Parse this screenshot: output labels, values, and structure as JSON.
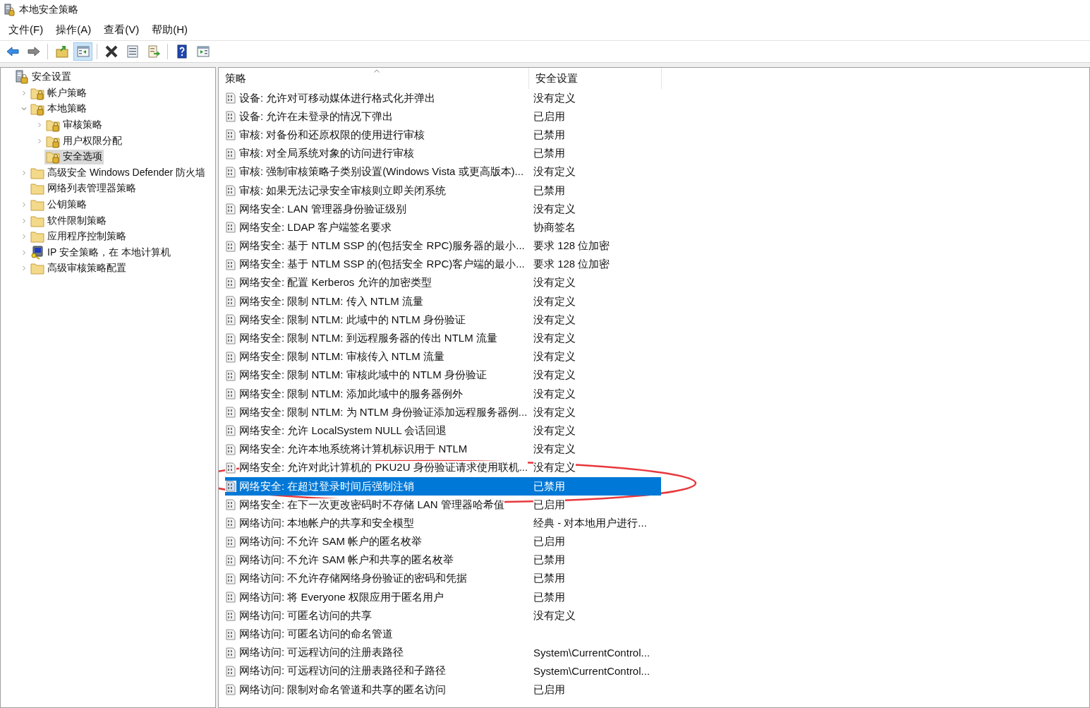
{
  "window": {
    "title": "本地安全策略"
  },
  "menu": [
    "文件(F)",
    "操作(A)",
    "查看(V)",
    "帮助(H)"
  ],
  "toolbar": [
    [
      {
        "kind": "back",
        "pressed": false
      },
      {
        "kind": "forward",
        "pressed": false
      }
    ],
    [
      {
        "kind": "up",
        "pressed": false
      },
      {
        "kind": "tree",
        "pressed": true
      }
    ],
    [
      {
        "kind": "delete",
        "pressed": false
      },
      {
        "kind": "properties",
        "pressed": false
      },
      {
        "kind": "export",
        "pressed": false
      }
    ],
    [
      {
        "kind": "help",
        "pressed": false
      },
      {
        "kind": "pane",
        "pressed": false
      }
    ]
  ],
  "tree": [
    {
      "label": "安全设置",
      "kind": "server",
      "selected": false,
      "children": [
        {
          "label": "帐户策略",
          "kind": "lockfolder",
          "expanded": false,
          "selected": false
        },
        {
          "label": "本地策略",
          "kind": "lockfolder",
          "expanded": true,
          "selected": false,
          "children": [
            {
              "label": "审核策略",
              "kind": "lockfolder",
              "expanded": false,
              "selected": false
            },
            {
              "label": "用户权限分配",
              "kind": "lockfolder",
              "expanded": false,
              "selected": false
            },
            {
              "label": "安全选项",
              "kind": "lockfolder",
              "selected": true
            }
          ]
        },
        {
          "label": "高级安全 Windows Defender 防火墙",
          "kind": "folder",
          "expanded": false,
          "selected": false
        },
        {
          "label": "网络列表管理器策略",
          "kind": "folder",
          "selected": false
        },
        {
          "label": "公钥策略",
          "kind": "folder",
          "expanded": false,
          "selected": false
        },
        {
          "label": "软件限制策略",
          "kind": "folder",
          "expanded": false,
          "selected": false
        },
        {
          "label": "应用程序控制策略",
          "kind": "folder",
          "expanded": false,
          "selected": false
        },
        {
          "label": "IP 安全策略，在 本地计算机",
          "kind": "computer",
          "expanded": false,
          "selected": false
        },
        {
          "label": "高级审核策略配置",
          "kind": "folder",
          "expanded": false,
          "selected": false
        }
      ]
    }
  ],
  "table": {
    "columns": [
      {
        "label": "策略",
        "sorted": true
      },
      {
        "label": "安全设置",
        "sorted": false
      }
    ],
    "rows": [
      {
        "policy": "设备: 允许对可移动媒体进行格式化并弹出",
        "setting": "没有定义",
        "selected": false
      },
      {
        "policy": "设备: 允许在未登录的情况下弹出",
        "setting": "已启用",
        "selected": false
      },
      {
        "policy": "审核: 对备份和还原权限的使用进行审核",
        "setting": "已禁用",
        "selected": false
      },
      {
        "policy": "审核: 对全局系统对象的访问进行审核",
        "setting": "已禁用",
        "selected": false
      },
      {
        "policy": "审核: 强制审核策略子类别设置(Windows Vista 或更高版本)...",
        "setting": "没有定义",
        "selected": false
      },
      {
        "policy": "审核: 如果无法记录安全审核则立即关闭系统",
        "setting": "已禁用",
        "selected": false
      },
      {
        "policy": "网络安全: LAN 管理器身份验证级别",
        "setting": "没有定义",
        "selected": false
      },
      {
        "policy": "网络安全: LDAP 客户端签名要求",
        "setting": "协商签名",
        "selected": false
      },
      {
        "policy": "网络安全: 基于 NTLM SSP 的(包括安全 RPC)服务器的最小...",
        "setting": "要求 128 位加密",
        "selected": false
      },
      {
        "policy": "网络安全: 基于 NTLM SSP 的(包括安全 RPC)客户端的最小...",
        "setting": "要求 128 位加密",
        "selected": false
      },
      {
        "policy": "网络安全: 配置 Kerberos 允许的加密类型",
        "setting": "没有定义",
        "selected": false
      },
      {
        "policy": "网络安全: 限制 NTLM: 传入 NTLM 流量",
        "setting": "没有定义",
        "selected": false
      },
      {
        "policy": "网络安全: 限制 NTLM: 此域中的 NTLM 身份验证",
        "setting": "没有定义",
        "selected": false
      },
      {
        "policy": "网络安全: 限制 NTLM: 到远程服务器的传出 NTLM 流量",
        "setting": "没有定义",
        "selected": false
      },
      {
        "policy": "网络安全: 限制 NTLM: 审核传入 NTLM 流量",
        "setting": "没有定义",
        "selected": false
      },
      {
        "policy": "网络安全: 限制 NTLM: 审核此域中的 NTLM 身份验证",
        "setting": "没有定义",
        "selected": false
      },
      {
        "policy": "网络安全: 限制 NTLM: 添加此域中的服务器例外",
        "setting": "没有定义",
        "selected": false
      },
      {
        "policy": "网络安全: 限制 NTLM: 为 NTLM 身份验证添加远程服务器例...",
        "setting": "没有定义",
        "selected": false
      },
      {
        "policy": "网络安全: 允许 LocalSystem NULL 会话回退",
        "setting": "没有定义",
        "selected": false
      },
      {
        "policy": "网络安全: 允许本地系统将计算机标识用于 NTLM",
        "setting": "没有定义",
        "selected": false
      },
      {
        "policy": "网络安全: 允许对此计算机的 PKU2U 身份验证请求使用联机...",
        "setting": "没有定义",
        "selected": false
      },
      {
        "policy": "网络安全: 在超过登录时间后强制注销",
        "setting": "已禁用",
        "selected": true
      },
      {
        "policy": "网络安全: 在下一次更改密码时不存储 LAN 管理器哈希值",
        "setting": "已启用",
        "selected": false
      },
      {
        "policy": "网络访问: 本地帐户的共享和安全模型",
        "setting": "经典 - 对本地用户进行...",
        "selected": false
      },
      {
        "policy": "网络访问: 不允许 SAM 帐户的匿名枚举",
        "setting": "已启用",
        "selected": false
      },
      {
        "policy": "网络访问: 不允许 SAM 帐户和共享的匿名枚举",
        "setting": "已禁用",
        "selected": false
      },
      {
        "policy": "网络访问: 不允许存储网络身份验证的密码和凭据",
        "setting": "已禁用",
        "selected": false
      },
      {
        "policy": "网络访问: 将 Everyone 权限应用于匿名用户",
        "setting": "已禁用",
        "selected": false
      },
      {
        "policy": "网络访问: 可匿名访问的共享",
        "setting": "没有定义",
        "selected": false
      },
      {
        "policy": "网络访问: 可匿名访问的命名管道",
        "selected": false
      },
      {
        "policy": "网络访问: 可远程访问的注册表路径",
        "setting": "System\\CurrentControl...",
        "selected": false
      },
      {
        "policy": "网络访问: 可远程访问的注册表路径和子路径",
        "setting": "System\\CurrentControl...",
        "selected": false
      },
      {
        "policy": "网络访问: 限制对命名管道和共享的匿名访问",
        "setting": "已启用",
        "selected": false
      }
    ]
  },
  "annotation": {
    "kind": "ellipse",
    "color": "#e8383d"
  }
}
